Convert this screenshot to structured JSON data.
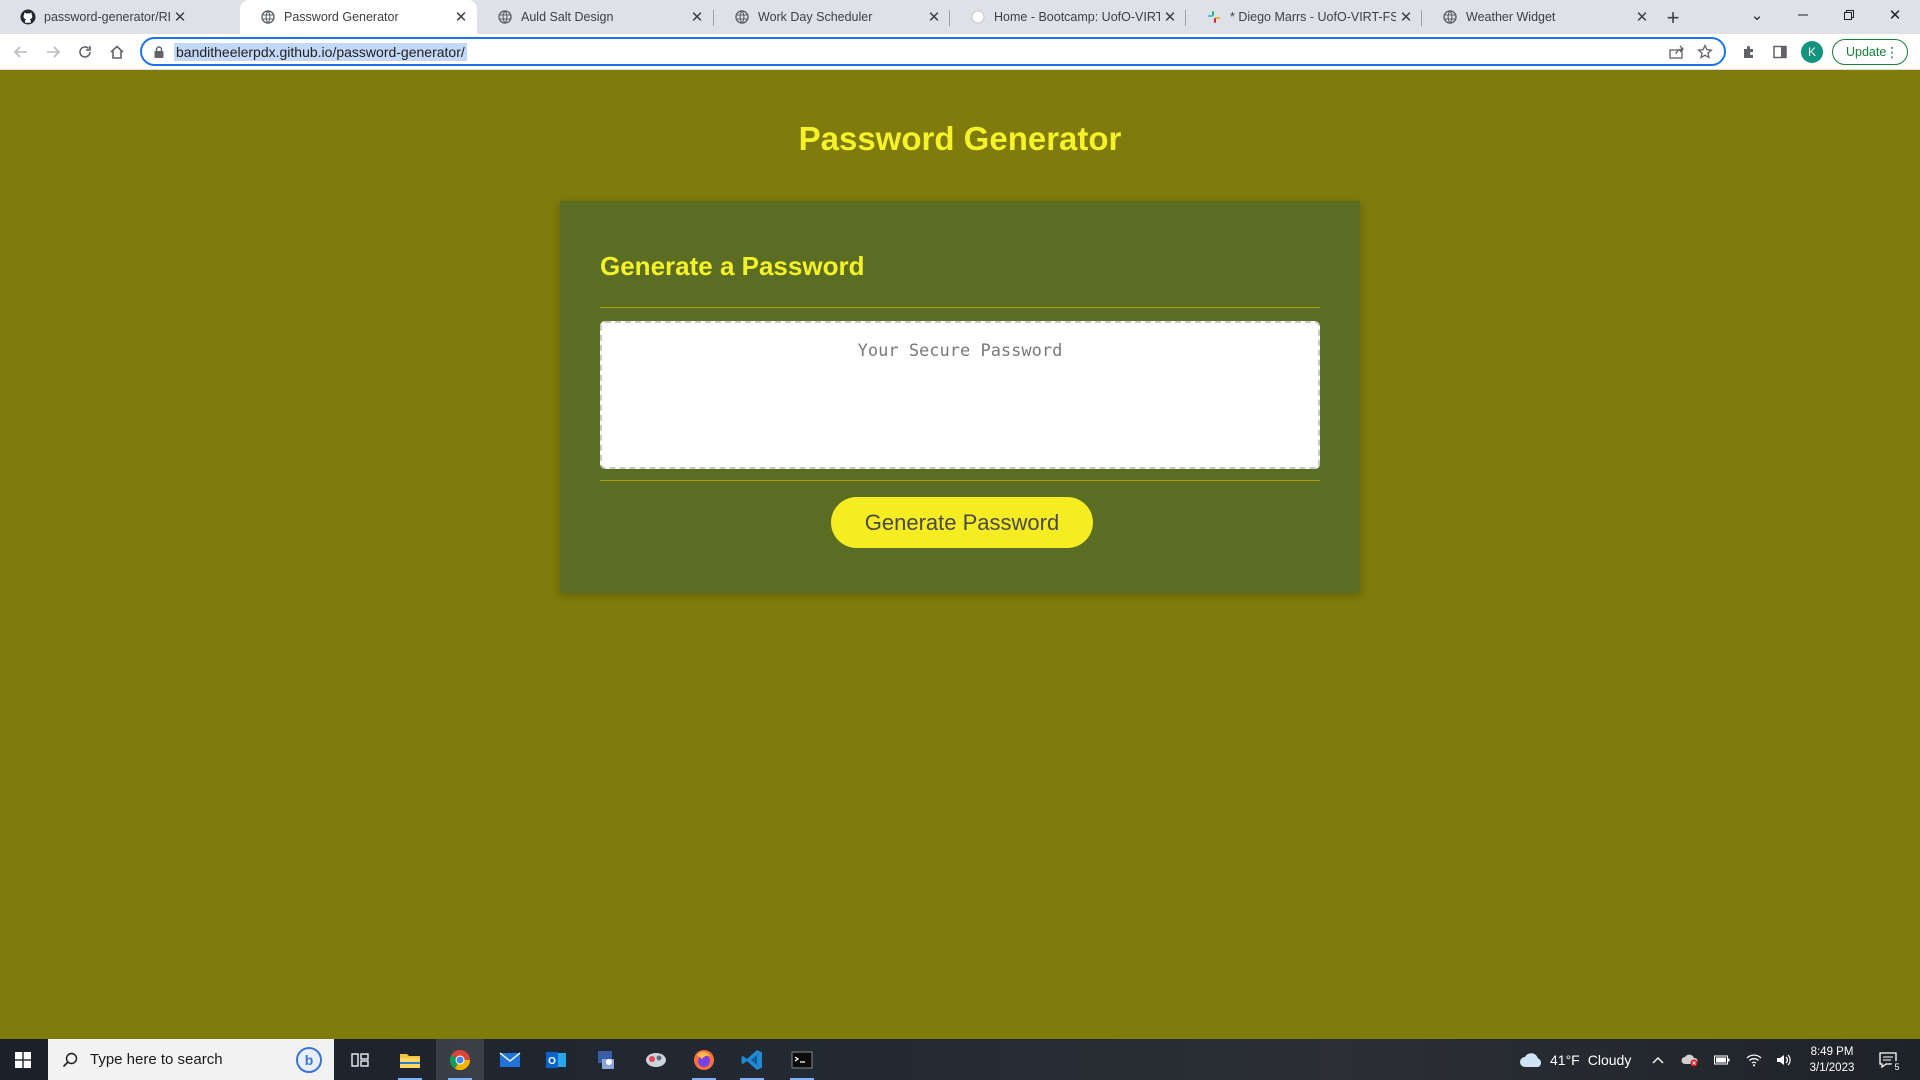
{
  "browser": {
    "tabs": [
      {
        "title": "password-generator/README.m",
        "icon": "github-icon",
        "active": false
      },
      {
        "title": "Password Generator",
        "icon": "globe-icon",
        "active": true
      },
      {
        "title": "Auld Salt Design",
        "icon": "globe-icon",
        "active": false
      },
      {
        "title": "Work Day Scheduler",
        "icon": "globe-icon",
        "active": false
      },
      {
        "title": "Home - Bootcamp: UofO-VIRT-F",
        "icon": "canvas-icon",
        "active": false
      },
      {
        "title": "* Diego Marrs - UofO-VIRT-FSF-",
        "icon": "slack-icon",
        "active": false
      },
      {
        "title": "Weather Widget",
        "icon": "globe-icon",
        "active": false
      }
    ],
    "url": "banditheelerpdx.github.io/password-generator/",
    "profile_initial": "K",
    "update_label": "Update"
  },
  "page": {
    "title": "Password Generator",
    "card_header": "Generate a Password",
    "password_placeholder": "Your Secure Password",
    "generate_button": "Generate Password"
  },
  "colors": {
    "page_background": "#7f7b0c",
    "card_background": "#5a6d22",
    "accent_yellow": "#f5f22a",
    "button_yellow": "#f5ec22"
  },
  "taskbar": {
    "search_placeholder": "Type here to search",
    "weather_temp": "41°F",
    "weather_desc": "Cloudy",
    "time": "8:49 PM",
    "date": "3/1/2023",
    "notification_count": "5",
    "apps": [
      "task-view-icon",
      "file-explorer-icon",
      "chrome-icon",
      "mail-icon",
      "outlook-icon",
      "app-icon",
      "app-icon",
      "firefox-icon",
      "vscode-icon",
      "terminal-icon"
    ]
  }
}
